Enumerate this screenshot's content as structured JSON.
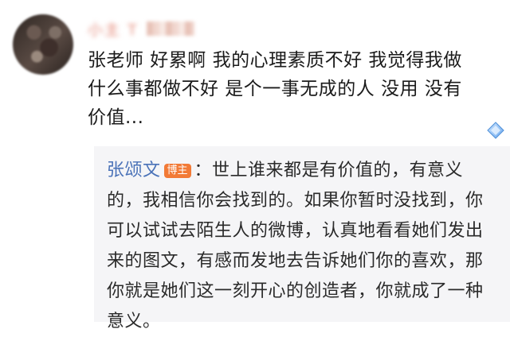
{
  "comment": {
    "username": "小主 T",
    "text": "张老师 好累啊 我的心理素质不好 我觉得我做\n什么事都做不好 是个一事无成的人 没用 没有\n价值..."
  },
  "reply": {
    "author": "张颂文",
    "badge": "博主",
    "separator": "：",
    "text": "世上谁来都是有价值的，有意义的，我相信你会找到的。如果你暂时没找到，你可以试试去陌生人的微博，认真地看看她们发出来的图文，有感而发地去告诉她们你的喜欢，那你就是她们这一刻开心的创造者，你就成了一种意义。"
  },
  "icons": {
    "avatar": "user-avatar",
    "decor": "diamond-sticker-icon"
  },
  "colors": {
    "author_link": "#4a72b8",
    "badge_bg": "#f27a36",
    "reply_bg": "#f5f5f7"
  }
}
